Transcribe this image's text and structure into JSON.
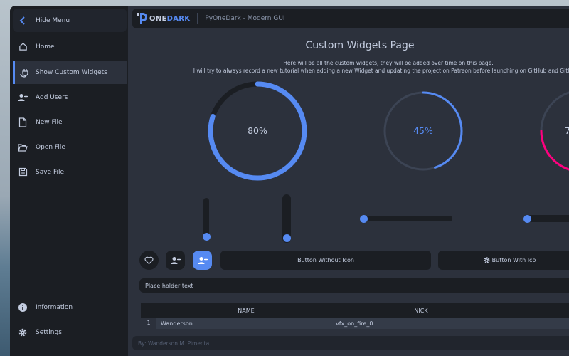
{
  "window": {
    "logo_prefix": "O",
    "logo_mid": "NE",
    "logo_accent": "DARK",
    "title": "PyOneDark - Modern GUI"
  },
  "menu": {
    "hide_label": "Hide Menu",
    "items": [
      {
        "label": "Home",
        "icon": "home-icon"
      },
      {
        "label": "Show Custom Widgets",
        "icon": "plug-icon",
        "active": true
      },
      {
        "label": "Add Users",
        "icon": "add-user-icon"
      },
      {
        "label": "New File",
        "icon": "file-icon"
      },
      {
        "label": "Open File",
        "icon": "folder-open-icon"
      },
      {
        "label": "Save File",
        "icon": "save-icon"
      }
    ],
    "bottom_items": [
      {
        "label": "Information",
        "icon": "info-icon"
      },
      {
        "label": "Settings",
        "icon": "gear-icon"
      }
    ]
  },
  "page": {
    "title": "Custom Widgets Page",
    "description_line1": "Here will be all the custom widgets, they will be added over time on this page.",
    "description_line2": "I will try to always record a new tutorial when adding a new Widget and updating the project on Patreon before launching on GitHub and GitHub a"
  },
  "progress": [
    {
      "text": "80%",
      "value": 0.8,
      "color": "#568af2"
    },
    {
      "text": "45%",
      "value": 0.45,
      "color": "#568af2"
    },
    {
      "text": "7",
      "value": 0.75,
      "color": "#ff007f"
    }
  ],
  "sliders": {
    "vertical_1": 0.0,
    "vertical_2": 0.0,
    "horizontal_1": 0.0,
    "horizontal_2": 0.0
  },
  "buttons": {
    "without_icon": "Button Without Icon",
    "with_icon": "Button With Ico"
  },
  "input": {
    "placeholder": "Place holder text"
  },
  "table": {
    "headers": [
      "NAME",
      "NICK"
    ],
    "rows": [
      {
        "index": "1",
        "name": "Wanderson",
        "nick": "vfx_on_fire_0"
      }
    ]
  },
  "footer": {
    "credit": "By: Wanderson M. Pimenta"
  },
  "colors": {
    "accent": "#568af2",
    "pink": "#ff007f",
    "bg_dark": "#1b1e23",
    "bg_main": "#2c313c"
  }
}
